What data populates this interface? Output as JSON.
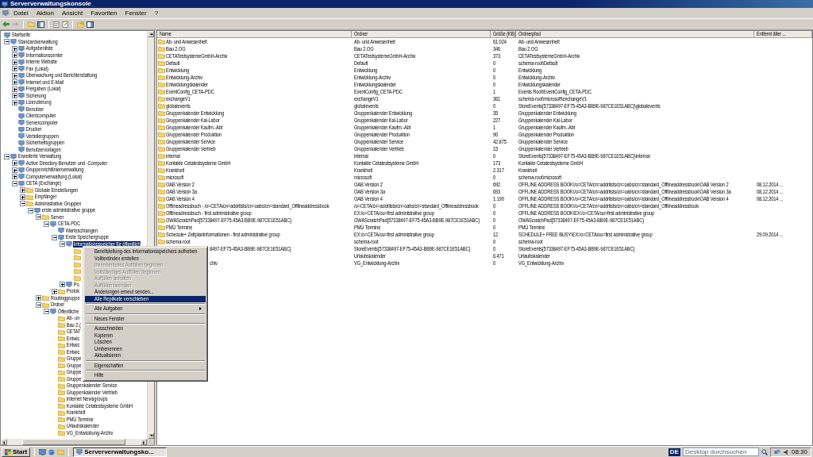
{
  "window": {
    "title": "Serververwaltungskonsole"
  },
  "menu_bar": [
    "Datei",
    "Aktion",
    "Ansicht",
    "Favoriten",
    "Fenster",
    "?"
  ],
  "tree": {
    "items": [
      {
        "label": "Startseite",
        "kind": "node",
        "selected": false
      },
      {
        "label": "Standardverwaltung",
        "kind": "node",
        "expanded": true,
        "selected": false,
        "children": [
          {
            "label": "Aufgabenliste",
            "kind": "node",
            "expanded": false,
            "selected": false
          },
          {
            "label": "Informationscenter",
            "kind": "node",
            "expanded": false,
            "selected": false
          },
          {
            "label": "Interne Website",
            "kind": "node",
            "expanded": false,
            "selected": false
          },
          {
            "label": "Fax (Lokal)",
            "kind": "node",
            "expanded": false,
            "selected": false
          },
          {
            "label": "Überwachung und Berichterstattung",
            "kind": "node",
            "expanded": false,
            "selected": false
          },
          {
            "label": "Internet und E-Mail",
            "kind": "node",
            "expanded": false,
            "selected": false
          },
          {
            "label": "Freigaben (Lokal)",
            "kind": "node",
            "expanded": false,
            "selected": false
          },
          {
            "label": "Sicherung",
            "kind": "node",
            "expanded": false,
            "selected": false
          },
          {
            "label": "Lizenzierung",
            "kind": "node",
            "expanded": false,
            "selected": false
          },
          {
            "label": "Benutzer",
            "kind": "node",
            "selected": false
          },
          {
            "label": "Clientcomputer",
            "kind": "node",
            "selected": false
          },
          {
            "label": "Servercomputer",
            "kind": "node",
            "selected": false
          },
          {
            "label": "Drucker",
            "kind": "node",
            "selected": false
          },
          {
            "label": "Verteilergruppen",
            "kind": "node",
            "selected": false
          },
          {
            "label": "Sicherheitsgruppen",
            "kind": "node",
            "selected": false
          },
          {
            "label": "Benutzervorlagen",
            "kind": "node",
            "selected": false
          }
        ]
      },
      {
        "label": "Erweiterte Verwaltung",
        "kind": "node",
        "expanded": true,
        "selected": false,
        "children": [
          {
            "label": "Active Directory-Benutzer und -Computer",
            "kind": "node",
            "expanded": false,
            "selected": false
          },
          {
            "label": "Gruppenrichtlinienverwaltung",
            "kind": "node",
            "expanded": false,
            "selected": false
          },
          {
            "label": "Computerverwaltung (Lokal)",
            "kind": "node",
            "expanded": false,
            "selected": false
          },
          {
            "label": "CETA (Exchange)",
            "kind": "node",
            "expanded": true,
            "selected": false,
            "children": [
              {
                "label": "Globale Einstellungen",
                "kind": "folder",
                "expanded": false,
                "selected": false
              },
              {
                "label": "Empfänger",
                "kind": "folder",
                "expanded": false,
                "selected": false
              },
              {
                "label": "Administrative Gruppen",
                "kind": "folder",
                "expanded": true,
                "selected": false,
                "children": [
                  {
                    "label": "erste administrative gruppe",
                    "kind": "node",
                    "expanded": true,
                    "selected": false,
                    "children": [
                      {
                        "label": "Server",
                        "kind": "folder",
                        "expanded": true,
                        "selected": false,
                        "children": [
                          {
                            "label": "CETA-PDC",
                            "kind": "node",
                            "expanded": true,
                            "selected": false,
                            "children": [
                              {
                                "label": "Warteschlangen",
                                "kind": "node",
                                "selected": false
                              },
                              {
                                "label": "Erste Speichergruppe",
                                "kind": "node",
                                "expanded": true,
                                "selected": false,
                                "children": [
                                  {
                                    "label": "Informationsspeicher für öffentlich",
                                    "kind": "node",
                                    "expanded": true,
                                    "selected": true,
                                    "children": [
                                      {
                                        "kind": "folder",
                                        "selected": false
                                      },
                                      {
                                        "kind": "folder",
                                        "selected": false
                                      },
                                      {
                                        "kind": "folder",
                                        "selected": false
                                      },
                                      {
                                        "kind": "folder",
                                        "selected": false
                                      },
                                      {
                                        "kind": "folder",
                                        "selected": false
                                      }
                                    ]
                                  },
                                  {
                                    "label": "Po",
                                    "kind": "node",
                                    "expanded": false,
                                    "selected": false
                                  }
                                ]
                              },
                              {
                                "label": "Protok",
                                "kind": "folder",
                                "expanded": false,
                                "selected": false
                              }
                            ]
                          }
                        ]
                      },
                      {
                        "label": "Routinggruppe",
                        "kind": "folder",
                        "expanded": false,
                        "selected": false
                      },
                      {
                        "label": "Ordner",
                        "kind": "folder",
                        "expanded": true,
                        "selected": false,
                        "children": [
                          {
                            "label": "Öffentliche",
                            "kind": "node",
                            "expanded": true,
                            "selected": false,
                            "children": [
                              {
                                "label": "Ab- un",
                                "kind": "folder",
                                "selected": false
                              },
                              {
                                "label": "Bau 2.(",
                                "kind": "folder",
                                "selected": false
                              },
                              {
                                "label": "CETAT",
                                "kind": "folder",
                                "selected": false
                              },
                              {
                                "label": "Entwic",
                                "kind": "folder",
                                "selected": false
                              },
                              {
                                "label": "Entwic",
                                "kind": "folder",
                                "selected": false
                              },
                              {
                                "label": "Entwic",
                                "kind": "folder",
                                "selected": false
                              },
                              {
                                "label": "Gruppe",
                                "kind": "folder",
                                "selected": false
                              },
                              {
                                "label": "Gruppe",
                                "kind": "folder",
                                "selected": false
                              },
                              {
                                "label": "Gruppe",
                                "kind": "folder",
                                "selected": false
                              },
                              {
                                "label": "Gruppe",
                                "kind": "folder",
                                "selected": false
                              },
                              {
                                "label": "Gruppenkalender Service",
                                "kind": "folder",
                                "selected": false
                              },
                              {
                                "label": "Gruppenkalender Vertrieb",
                                "kind": "folder",
                                "selected": false
                              },
                              {
                                "label": "Internet Newsgroups",
                                "kind": "folder",
                                "selected": false
                              },
                              {
                                "label": "Kontakte Cetatestsysteme GmbH",
                                "kind": "folder",
                                "selected": false
                              },
                              {
                                "label": "Krankheit",
                                "kind": "folder",
                                "selected": false
                              },
                              {
                                "label": "PMÜ Termine",
                                "kind": "folder",
                                "selected": false
                              },
                              {
                                "label": "Urlaubskalender",
                                "kind": "folder",
                                "selected": false
                              },
                              {
                                "label": "VG_Entwicklung-Archiv",
                                "kind": "folder",
                                "selected": false
                              }
                            ]
                          }
                        ]
                      }
                    ]
                  }
                ]
              }
            ]
          }
        ]
      }
    ]
  },
  "table": {
    "columns": [
      "Name",
      "Ordner",
      "Größe (KB)",
      "Ordnerpfad",
      "Entfernt älter ..."
    ],
    "rows": [
      {
        "kind": "folder",
        "name": "Ab- und Anwesenheit",
        "folder": "Ab- und Anwesenheit",
        "size": "61.024",
        "path": "Ab- und Anwesenheit"
      },
      {
        "kind": "folder",
        "name": "Bau 2.OG",
        "folder": "Bau 2.OG",
        "size": "346",
        "path": "Bau 2.OG"
      },
      {
        "kind": "folder",
        "name": "CETATestsystemeGmbH-Archiv",
        "folder": "CETATestsystemeGmbH-Archiv",
        "size": "373",
        "path": "CETATestsystemeGmbH-Archiv"
      },
      {
        "kind": "folder",
        "name": "Default",
        "folder": "Default",
        "size": "0",
        "path": "schema-root\\Default"
      },
      {
        "kind": "folder",
        "name": "Entwicklung",
        "folder": "Entwicklung",
        "size": "0",
        "path": "Entwicklung"
      },
      {
        "kind": "folder",
        "name": "Entwicklung-Archiv",
        "folder": "Entwicklung-Archiv",
        "size": "0",
        "path": "Entwicklung-Archiv"
      },
      {
        "kind": "folder",
        "name": "Entwicklungskalender",
        "folder": "Entwicklungskalender",
        "size": "0",
        "path": "Entwicklungskalender"
      },
      {
        "kind": "folder",
        "name": "EventConfig_CETA-PDC",
        "folder": "EventConfig_CETA-PDC",
        "size": "1",
        "path": "Events Root\\EventConfig_CETA-PDC"
      },
      {
        "kind": "folder",
        "name": "exchangeV1",
        "folder": "exchangeV1",
        "size": "361",
        "path": "schema-root\\microsoft\\exchangeV1"
      },
      {
        "kind": "folder",
        "name": "globalevents",
        "folder": "globalevents",
        "size": "0",
        "path": "StoreEvents{57338497-EF75-45A3-BB9E-987CE1E51ABC}\\globalevents"
      },
      {
        "kind": "folder",
        "name": "Gruppenkalender Entwicklung",
        "folder": "Gruppenkalender Entwicklung",
        "size": "35",
        "path": "Gruppenkalender Entwicklung"
      },
      {
        "kind": "folder",
        "name": "Gruppenkalender Kal-Labor",
        "folder": "Gruppenkalender Kal-Labor",
        "size": "227",
        "path": "Gruppenkalender Kal-Labor"
      },
      {
        "kind": "folder",
        "name": "Gruppenkalender Kaufm.-Abt",
        "folder": "Gruppenkalender Kaufm.-Abt",
        "size": "1",
        "path": "Gruppenkalender Kaufm.-Abt"
      },
      {
        "kind": "folder",
        "name": "Gruppenkalender Produktion",
        "folder": "Gruppenkalender Produktion",
        "size": "90",
        "path": "Gruppenkalender Produktion"
      },
      {
        "kind": "folder",
        "name": "Gruppenkalender Service",
        "folder": "Gruppenkalender Service",
        "size": "42.875",
        "path": "Gruppenkalender Service"
      },
      {
        "kind": "folder",
        "name": "Gruppenkalender Vertrieb",
        "folder": "Gruppenkalender Vertrieb",
        "size": "15",
        "path": "Gruppenkalender Vertrieb"
      },
      {
        "kind": "folder",
        "name": "internal",
        "folder": "internal",
        "size": "0",
        "path": "StoreEvents{57338497-EF75-45A3-BB9E-987CE1E51ABC}\\internal"
      },
      {
        "kind": "folder",
        "name": "Kontakte Cetatestsysteme GmbH",
        "folder": "Kontakte Cetatestsysteme GmbH",
        "size": "173",
        "path": "Kontakte Cetatestsysteme GmbH"
      },
      {
        "kind": "folder",
        "name": "Krankheit",
        "folder": "Krankheit",
        "size": "2.317",
        "path": "Krankheit"
      },
      {
        "kind": "folder",
        "name": "microsoft",
        "folder": "microsoft",
        "size": "0",
        "path": "schema-root\\microsoft"
      },
      {
        "kind": "folder",
        "name": "OAB Version 2",
        "folder": "OAB Version 2",
        "size": "692",
        "path": "OFFLINE ADDRESS BOOK\\/o=CETA/cn=addrlists/cn=oabs/cn=standard_Offlineaddressbook\\OAB Version 2",
        "removed": "08.12.2014 ..."
      },
      {
        "kind": "folder",
        "name": "OAB Version 3a",
        "folder": "OAB Version 3a",
        "size": "693",
        "path": "OFFLINE ADDRESS BOOK\\/o=CETA/cn=addrlists/cn=oabs/cn=standard_Offlineaddressbook\\OAB Version 3a",
        "removed": "08.12.2014 ..."
      },
      {
        "kind": "folder",
        "name": "OAB Version 4",
        "folder": "OAB Version 4",
        "size": "1.190",
        "path": "OFFLINE ADDRESS BOOK\\/o=CETA/cn=addrlists/cn=oabs/cn=standard_Offlineaddressbook\\OAB Version 4",
        "removed": "08.12.2014 ..."
      },
      {
        "kind": "folder",
        "name": "Offlineadressbuch - /o=CETA/cn=addrlists/cn=oabs/cn=standard_Offlineaddressbook",
        "folder": "/o=CETA/cn=addrlists/cn=oabs/cn=standard_Offlineaddressbook",
        "size": "0",
        "path": "OFFLINE ADDRESS BOOK\\/o=CETA/cn=addrlists/cn=oabs/cn=standard_Offlineaddressbook"
      },
      {
        "kind": "folder",
        "name": "Offlineadressbuch - first administrative group",
        "folder": "EX:/o=CETA/ou=first administrative group",
        "size": "0",
        "path": "OFFLINE ADDRESS BOOK\\EX:/o=CETA/ou=first administrative group"
      },
      {
        "kind": "folder",
        "name": "OWAScratchPad{57338497-EF75-45A3-BB9E-987CE1E51ABC}",
        "folder": "OWAScratchPad{57338497-EF75-45A3-BB9E-987CE1E51ABC}",
        "size": "0",
        "path": "OWAScratchPad{57338497-EF75-45A3-BB9E-987CE1E51ABC}"
      },
      {
        "kind": "folder",
        "name": "PMÜ Termine",
        "folder": "PMÜ Termine",
        "size": "0",
        "path": "PMÜ Termine"
      },
      {
        "kind": "folder",
        "name": "Schedule+ Zeitplaninformationen - first administrative group",
        "folder": "EX:/o=CETA/ou=first administrative group",
        "size": "12",
        "path": "SCHEDULE+ FREE BUSY\\EX:/o=CETA/ou=first administrative group",
        "removed": "29.09.2014 ..."
      },
      {
        "kind": "folder",
        "name": "schema-root",
        "folder": "schema-root",
        "size": "0",
        "path": "schema-root"
      },
      {
        "kind": "covered",
        "name": "8497-EF75-45A3-BB9E-987CE1E51ABC}",
        "folder": "StoreEvents{57338497-EF75-45A3-BB9E-987CE1E51ABC}",
        "size": "0",
        "path": "StoreEvents{57338497-EF75-45A3-BB9E-987CE1E51ABC}"
      },
      {
        "kind": "covered",
        "folder": "Urlaubskalender",
        "size": "6.471",
        "path": "Urlaubskalender"
      },
      {
        "kind": "covered",
        "name": "chiv",
        "folder": "VG_Entwicklung-Archiv",
        "size": "0",
        "path": "VG_Entwicklung-Archiv"
      }
    ]
  },
  "context_menu": {
    "items": [
      {
        "kind": "item",
        "label": "Bereitstellung des Informationsspeichers aufheben",
        "disabled": false,
        "selected": false
      },
      {
        "kind": "item",
        "label": "Volltextindex erstellen",
        "disabled": false,
        "selected": false
      },
      {
        "kind": "item",
        "label": "Inkrementelles Auffüllen beginnen",
        "disabled": true,
        "selected": false
      },
      {
        "kind": "item",
        "label": "Vollständiges Auffüllen beginnen",
        "disabled": true,
        "selected": false
      },
      {
        "kind": "item",
        "label": "Auffüllen anhalten",
        "disabled": true,
        "selected": false
      },
      {
        "kind": "item",
        "label": "Auffüllen beenden",
        "disabled": true,
        "selected": false
      },
      {
        "kind": "item",
        "label": "Änderungen erneut senden...",
        "disabled": false,
        "selected": false
      },
      {
        "kind": "item",
        "label": "Alle Replikate verschieben",
        "disabled": false,
        "selected": true
      },
      {
        "kind": "separator"
      },
      {
        "kind": "submenu",
        "label": "Alle Aufgaben",
        "disabled": false,
        "selected": false
      },
      {
        "kind": "separator"
      },
      {
        "kind": "item",
        "label": "Neues Fenster",
        "disabled": false,
        "selected": false
      },
      {
        "kind": "separator"
      },
      {
        "kind": "item",
        "label": "Ausschneiden",
        "disabled": false,
        "selected": false
      },
      {
        "kind": "item",
        "label": "Kopieren",
        "disabled": false,
        "selected": false
      },
      {
        "kind": "item",
        "label": "Löschen",
        "disabled": false,
        "selected": false
      },
      {
        "kind": "item",
        "label": "Umbenennen",
        "disabled": false,
        "selected": false
      },
      {
        "kind": "item",
        "label": "Aktualisieren",
        "disabled": false,
        "selected": false
      },
      {
        "kind": "separator"
      },
      {
        "kind": "item",
        "label": "Eigenschaften",
        "disabled": false,
        "selected": false
      },
      {
        "kind": "separator"
      },
      {
        "kind": "item",
        "label": "Hilfe",
        "disabled": false,
        "selected": false
      }
    ]
  },
  "taskbar": {
    "start": "Start",
    "tasks": [
      {
        "label": "Serververwaltungsko...",
        "selected": true
      }
    ],
    "language": "DE",
    "search": {
      "placeholder": "Desktop durchsuchen"
    },
    "clock": "08:30"
  }
}
